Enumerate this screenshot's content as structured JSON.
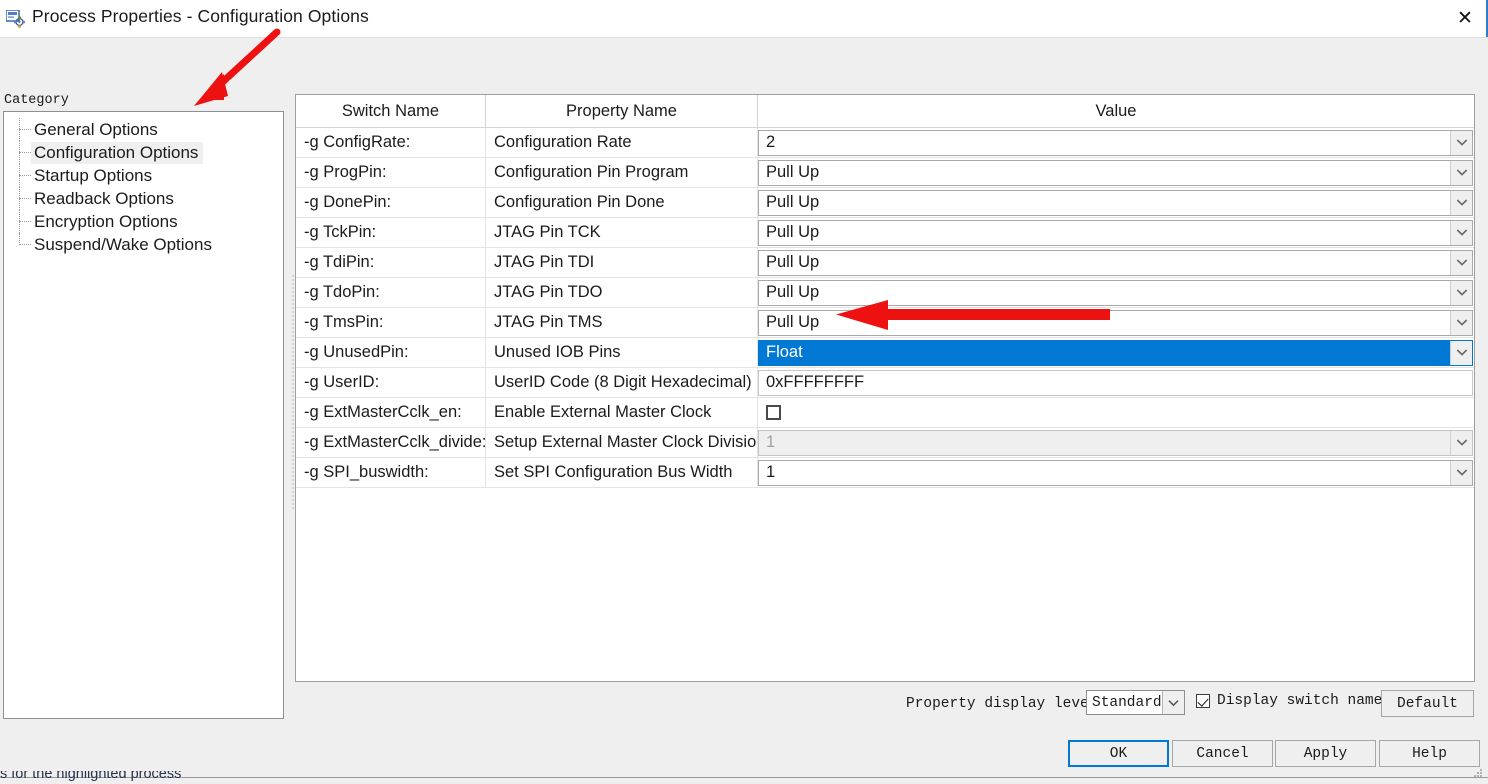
{
  "window": {
    "title": "Process Properties - Configuration Options",
    "icon": "properties-icon",
    "close_label": "✕"
  },
  "sidebar": {
    "heading": "Category",
    "items": [
      {
        "label": "General Options",
        "selected": false
      },
      {
        "label": "Configuration Options",
        "selected": true
      },
      {
        "label": "Startup Options",
        "selected": false
      },
      {
        "label": "Readback Options",
        "selected": false
      },
      {
        "label": "Encryption Options",
        "selected": false
      },
      {
        "label": "Suspend/Wake Options",
        "selected": false
      }
    ]
  },
  "grid": {
    "headers": {
      "switch": "Switch Name",
      "property": "Property Name",
      "value": "Value"
    },
    "rows": [
      {
        "switch": "-g ConfigRate:",
        "property": "Configuration Rate",
        "value": "2",
        "editor": "combo"
      },
      {
        "switch": "-g ProgPin:",
        "property": "Configuration Pin Program",
        "value": "Pull Up",
        "editor": "combo"
      },
      {
        "switch": "-g DonePin:",
        "property": "Configuration Pin Done",
        "value": "Pull Up",
        "editor": "combo"
      },
      {
        "switch": "-g TckPin:",
        "property": "JTAG Pin TCK",
        "value": "Pull Up",
        "editor": "combo"
      },
      {
        "switch": "-g TdiPin:",
        "property": "JTAG Pin TDI",
        "value": "Pull Up",
        "editor": "combo"
      },
      {
        "switch": "-g TdoPin:",
        "property": "JTAG Pin TDO",
        "value": "Pull Up",
        "editor": "combo"
      },
      {
        "switch": "-g TmsPin:",
        "property": "JTAG Pin TMS",
        "value": "Pull Up",
        "editor": "combo"
      },
      {
        "switch": "-g UnusedPin:",
        "property": "Unused IOB Pins",
        "value": "Float",
        "editor": "combo-selected"
      },
      {
        "switch": "-g UserID:",
        "property": "UserID Code (8 Digit Hexadecimal)",
        "value": "0xFFFFFFFF",
        "editor": "text"
      },
      {
        "switch": "-g ExtMasterCclk_en:",
        "property": "Enable External Master Clock",
        "value": "",
        "editor": "checkbox",
        "checked": false
      },
      {
        "switch": "-g ExtMasterCclk_divide:",
        "property": "Setup External Master Clock Division",
        "value": "1",
        "editor": "combo-disabled"
      },
      {
        "switch": "-g SPI_buswidth:",
        "property": "Set SPI Configuration Bus Width",
        "value": "1",
        "editor": "combo"
      }
    ]
  },
  "options_bar": {
    "display_level_label": "Property display level:",
    "display_level_value": "Standard",
    "display_switch_names_label": "Display switch names",
    "display_switch_names_checked": true,
    "default_button": "Default"
  },
  "actions": {
    "ok": "OK",
    "cancel": "Cancel",
    "apply": "Apply",
    "help": "Help"
  },
  "status": {
    "text": "s for the highlighted process"
  },
  "colors": {
    "selection_blue": "#0078d4",
    "focus_blue": "#0078d4",
    "annotation_red": "#ee1111",
    "dialog_bg": "#efefef"
  }
}
